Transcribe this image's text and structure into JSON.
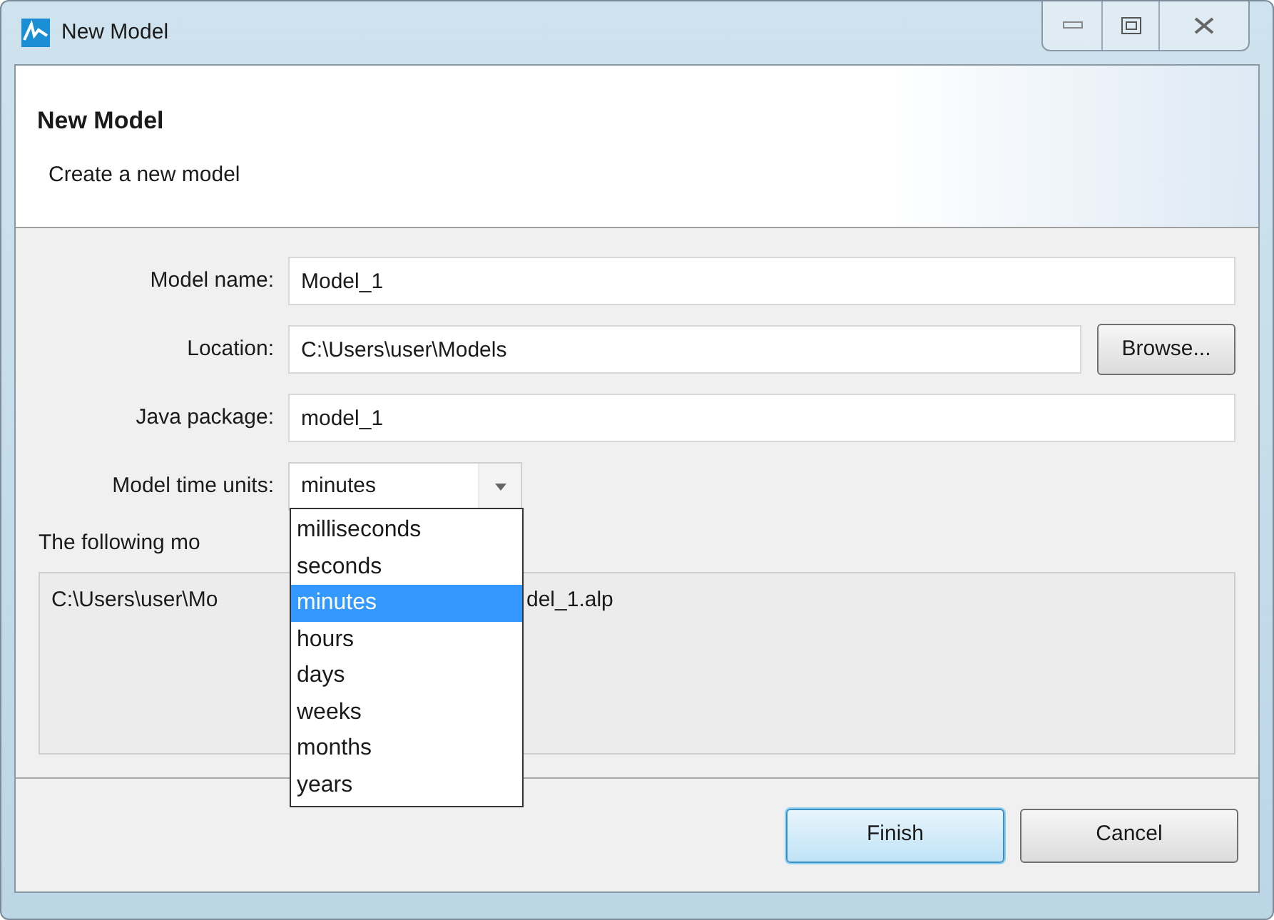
{
  "window": {
    "title": "New Model"
  },
  "header": {
    "title": "New Model",
    "subtitle": "Create a new model"
  },
  "fields": [
    {
      "label": "Model name:",
      "value": "Model_1"
    },
    {
      "label": "Location:",
      "value": "C:\\Users\\user\\Models",
      "button": "Browse..."
    },
    {
      "label": "Java package:",
      "value": "model_1"
    }
  ],
  "time_units": {
    "label": "Model time units:",
    "value": "minutes",
    "expanded": true,
    "options": [
      {
        "label": "milliseconds",
        "selected": false
      },
      {
        "label": "seconds",
        "selected": false
      },
      {
        "label": "minutes",
        "selected": true
      },
      {
        "label": "hours",
        "selected": false
      },
      {
        "label": "days",
        "selected": false
      },
      {
        "label": "weeks",
        "selected": false
      },
      {
        "label": "months",
        "selected": false
      },
      {
        "label": "years",
        "selected": false
      }
    ]
  },
  "files": {
    "label": "The following mo",
    "path_parts": [
      "C:\\Users\\user\\Mo",
      "del_1.alp"
    ]
  },
  "buttons": [
    {
      "label": "Finish",
      "default": true
    },
    {
      "label": "Cancel",
      "default": false
    }
  ]
}
